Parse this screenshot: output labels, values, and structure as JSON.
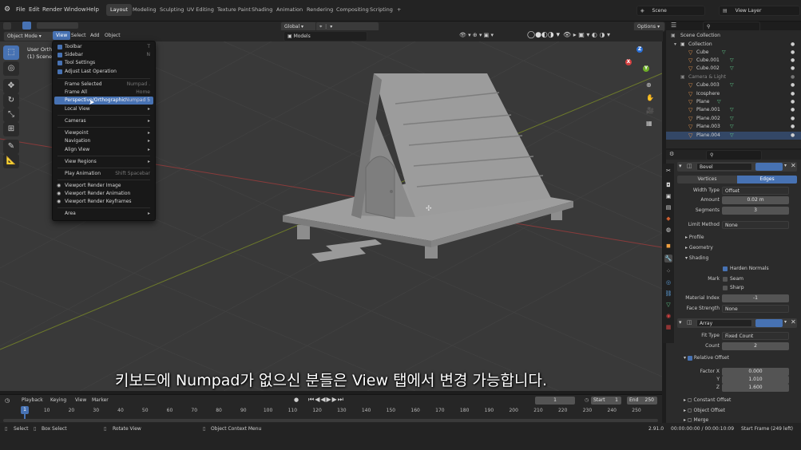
{
  "topbar": {
    "menus": [
      "File",
      "Edit",
      "Render",
      "Window",
      "Help"
    ],
    "workspaces": [
      "Layout",
      "Modeling",
      "Sculpting",
      "UV Editing",
      "Texture Paint",
      "Shading",
      "Animation",
      "Rendering",
      "Compositing",
      "Scripting"
    ],
    "active_workspace": "Layout",
    "add_tab": "+",
    "scene": "Scene",
    "view_layer": "View Layer"
  },
  "viewport_header": {
    "mode": "Object Mode",
    "menus": [
      "View",
      "Select",
      "Add",
      "Object"
    ],
    "transform": "Global",
    "collection": "Models",
    "options": "Options"
  },
  "viewport_info": {
    "line1": "User Ortho",
    "line2": "(1) Scene C"
  },
  "view_menu": {
    "items": [
      {
        "label": "Toolbar",
        "shortcut": "T",
        "check": true
      },
      {
        "label": "Sidebar",
        "shortcut": "N",
        "check": true
      },
      {
        "label": "Tool Settings",
        "shortcut": "",
        "check": true
      },
      {
        "label": "Adjust Last Operation",
        "shortcut": "",
        "check": true
      },
      {
        "label": "Frame Selected",
        "shortcut": "Numpad ."
      },
      {
        "label": "Frame All",
        "shortcut": "Home"
      },
      {
        "label": "Perspective/Orthographic",
        "shortcut": "Numpad 5",
        "highlight": true
      },
      {
        "label": "Local View",
        "arrow": "▸"
      },
      {
        "label": "Cameras",
        "arrow": "▸"
      },
      {
        "label": "Viewpoint",
        "arrow": "▸"
      },
      {
        "label": "Navigation",
        "arrow": "▸"
      },
      {
        "label": "Align View",
        "arrow": "▸"
      },
      {
        "label": "View Regions",
        "arrow": "▸"
      },
      {
        "label": "Play Animation",
        "shortcut": "Shift Spacebar"
      },
      {
        "label": "Viewport Render Image"
      },
      {
        "label": "Viewport Render Animation"
      },
      {
        "label": "Viewport Render Keyframes"
      },
      {
        "label": "Area",
        "arrow": "▸"
      }
    ]
  },
  "gizmo": {
    "x": "X",
    "y": "Y",
    "z": "Z"
  },
  "outliner": {
    "root": "Scene Collection",
    "rows": [
      "Collection",
      "Cube",
      "Cube.001",
      "Cube.002",
      "Camera & Light",
      "Cube.003",
      "Icosphere",
      "Plane",
      "Plane.001",
      "Plane.002",
      "Plane.003",
      "Plane.004"
    ]
  },
  "properties": {
    "modifier1": "Bevel",
    "tab_vertices": "Vertices",
    "tab_edges": "Edges",
    "width_type_label": "Width Type",
    "width_type": "Offset",
    "amount_label": "Amount",
    "amount": "0.02 m",
    "segments_label": "Segments",
    "segments": "3",
    "limit_method_label": "Limit Method",
    "limit_method": "None",
    "profile": "Profile",
    "geometry": "Geometry",
    "shading": "Shading",
    "harden_normals": "Harden Normals",
    "mark_label": "Mark",
    "seam": "Seam",
    "sharp": "Sharp",
    "material_index_label": "Material Index",
    "material_index": "-1",
    "face_strength_label": "Face Strength",
    "face_strength": "None",
    "modifier2": "Array",
    "fit_type_label": "Fit Type",
    "fit_type": "Fixed Count",
    "count_label": "Count",
    "count": "2",
    "relative_offset": "Relative Offset",
    "factor_x_label": "Factor X",
    "factor_x": "0.000",
    "y_label": "Y",
    "factor_y": "1.010",
    "z_label": "Z",
    "factor_z": "1.600",
    "constant_offset": "Constant Offset",
    "object_offset": "Object Offset",
    "merge": "Merge"
  },
  "subtitle": "키보드에 Numpad가 없으신 분들은 View 탭에서 변경 가능합니다.",
  "timeline": {
    "menus": [
      "Playback",
      "Keying",
      "View",
      "Marker"
    ],
    "current_frame": "1",
    "start_label": "Start",
    "start": "1",
    "end_label": "End",
    "end": "250",
    "ticks": [
      "1",
      "10",
      "20",
      "30",
      "40",
      "50",
      "60",
      "70",
      "80",
      "90",
      "100",
      "110",
      "120",
      "130",
      "140",
      "150",
      "160",
      "170",
      "180",
      "190",
      "200",
      "210",
      "220",
      "230",
      "240",
      "250"
    ]
  },
  "statusbar": {
    "select": "Select",
    "box_select": "Box Select",
    "rotate_view": "Rotate View",
    "context_menu": "Object Context Menu",
    "version": "2.91.0",
    "time": "00:00:00:00 / 00:00:10:09",
    "frames": "Start Frame (249 left)"
  },
  "colors": {
    "accent": "#4772b3",
    "orange": "#e0904b",
    "green": "#5fc98a"
  }
}
